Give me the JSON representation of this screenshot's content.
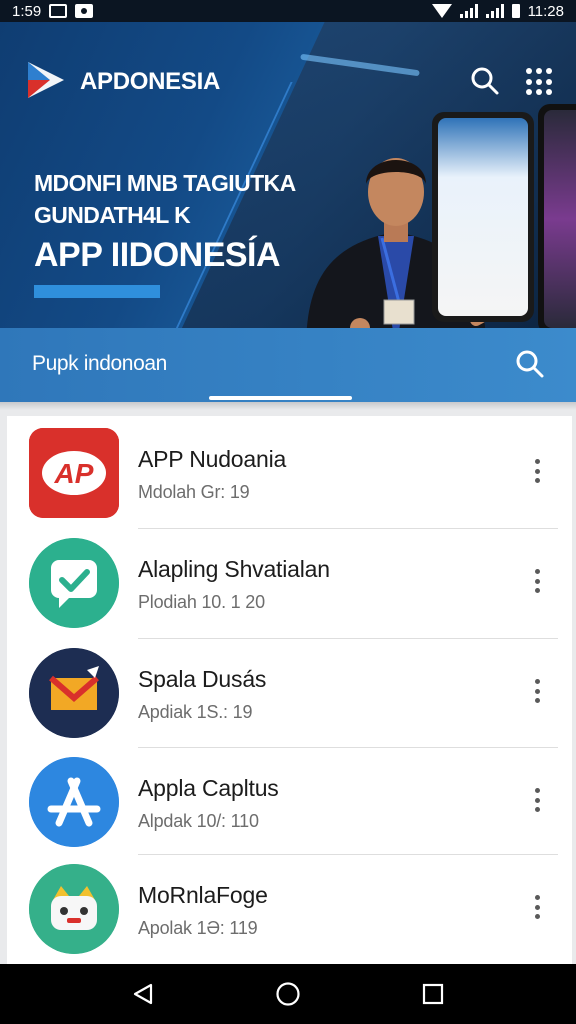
{
  "status_bar": {
    "time_left": "1:59",
    "time_right": "11:28"
  },
  "header": {
    "app_name": "APDONESIA",
    "icons": [
      "search-icon",
      "apps-grid-icon"
    ]
  },
  "hero": {
    "line1": "MDONFI MNB TAGIUTKA",
    "line2": "GUNDATH4L K",
    "line3": "APP IIDONESÍA"
  },
  "search_tab": {
    "label": "Pupk indonoan",
    "icon": "search-icon"
  },
  "apps": [
    {
      "title": "APP Nudoania",
      "subtitle": "Mdolah  Gr: 19",
      "icon": "app-logo-icon",
      "color": "#d9302b"
    },
    {
      "title": "Alapling Shvatialan",
      "subtitle": "Plodiah 10. 1 20",
      "icon": "checkmark-chat-icon",
      "color": "#2cb08e"
    },
    {
      "title": "Spala Dusás",
      "subtitle": "Apdiak 1S.: 19",
      "icon": "mail-envelope-icon",
      "color": "#1d2d52"
    },
    {
      "title": "Appla Capltus",
      "subtitle": "Alpdak 10/: 110",
      "icon": "app-store-a-icon",
      "color": "#2d87e0"
    },
    {
      "title": "MoRnlaFoge",
      "subtitle": "Apolak 1Ә: 119",
      "icon": "cat-mascot-icon",
      "color": "#35b08a"
    }
  ],
  "nav_bar": {
    "icons": [
      "back-icon",
      "home-icon",
      "recents-icon"
    ]
  },
  "colors": {
    "hero_blue": "#134a86",
    "tab_blue": "#2f77ba",
    "accent": "#2f8fdc"
  }
}
